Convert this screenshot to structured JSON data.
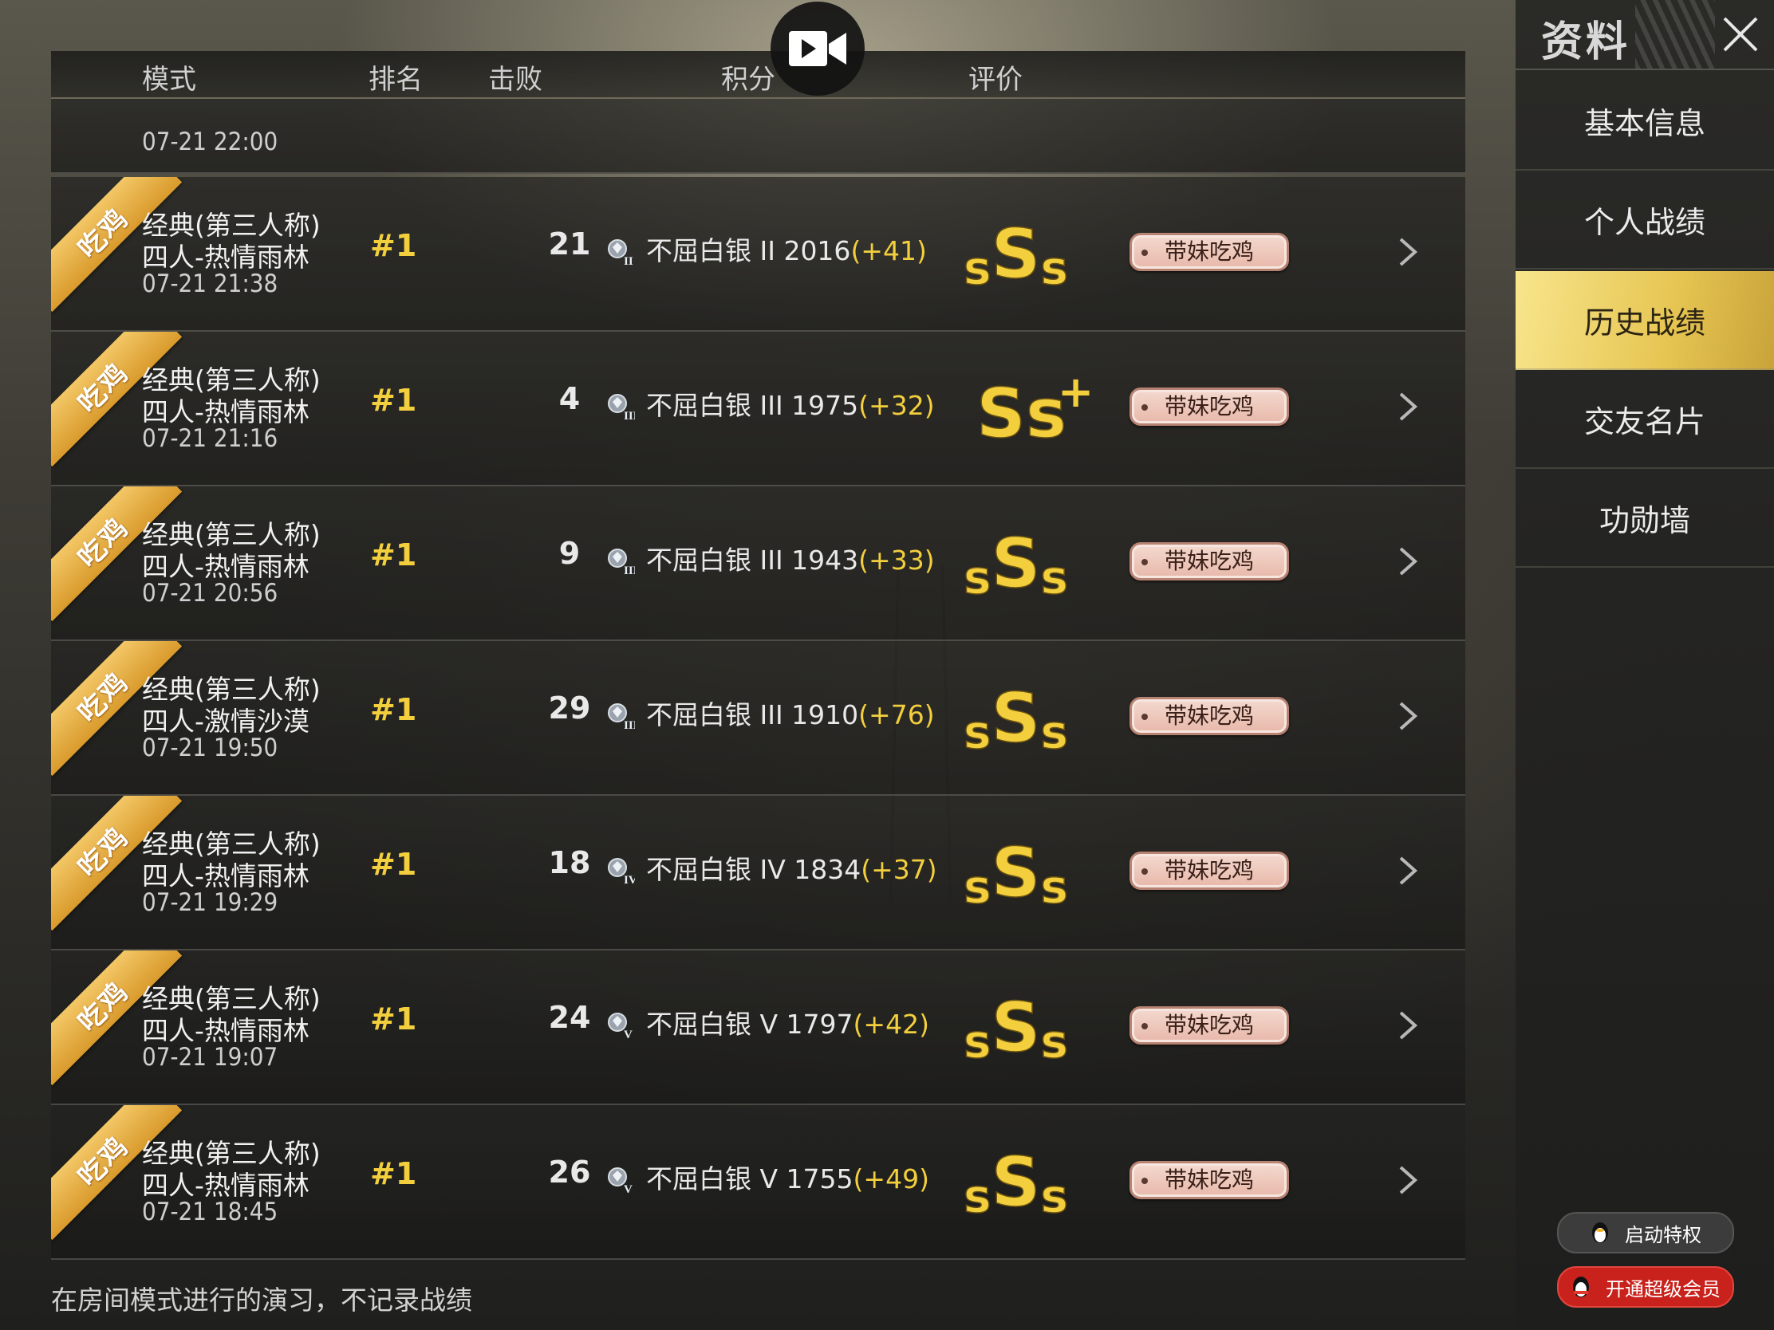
{
  "header": {
    "mode": "模式",
    "rank": "排名",
    "kills": "击败",
    "score": "积分",
    "grade": "评价"
  },
  "partial_row": {
    "time": "07-21 22:00"
  },
  "rows": [
    {
      "ribbon": "吃鸡",
      "mode_line1": "经典(第三人称)",
      "mode_line2": "四人-热情雨林",
      "time": "07-21 21:38",
      "rank": "#1",
      "kills": "21",
      "tier_numeral": "II",
      "score_text": "不屈白银 II 2016",
      "delta": "(+41)",
      "grade_text": "sSs",
      "tag": "带妹吃鸡"
    },
    {
      "ribbon": "吃鸡",
      "mode_line1": "经典(第三人称)",
      "mode_line2": "四人-热情雨林",
      "time": "07-21 21:16",
      "rank": "#1",
      "kills": "4",
      "tier_numeral": "III",
      "score_text": "不屈白银 III 1975",
      "delta": "(+32)",
      "grade_text": "Ss+",
      "tag": "带妹吃鸡"
    },
    {
      "ribbon": "吃鸡",
      "mode_line1": "经典(第三人称)",
      "mode_line2": "四人-热情雨林",
      "time": "07-21 20:56",
      "rank": "#1",
      "kills": "9",
      "tier_numeral": "III",
      "score_text": "不屈白银 III 1943",
      "delta": "(+33)",
      "grade_text": "sSs",
      "tag": "带妹吃鸡"
    },
    {
      "ribbon": "吃鸡",
      "mode_line1": "经典(第三人称)",
      "mode_line2": "四人-激情沙漠",
      "time": "07-21 19:50",
      "rank": "#1",
      "kills": "29",
      "tier_numeral": "III",
      "score_text": "不屈白银 III 1910",
      "delta": "(+76)",
      "grade_text": "sSs",
      "tag": "带妹吃鸡"
    },
    {
      "ribbon": "吃鸡",
      "mode_line1": "经典(第三人称)",
      "mode_line2": "四人-热情雨林",
      "time": "07-21 19:29",
      "rank": "#1",
      "kills": "18",
      "tier_numeral": "IV",
      "score_text": "不屈白银 IV 1834",
      "delta": "(+37)",
      "grade_text": "sSs",
      "tag": "带妹吃鸡"
    },
    {
      "ribbon": "吃鸡",
      "mode_line1": "经典(第三人称)",
      "mode_line2": "四人-热情雨林",
      "time": "07-21 19:07",
      "rank": "#1",
      "kills": "24",
      "tier_numeral": "V",
      "score_text": "不屈白银 V 1797",
      "delta": "(+42)",
      "grade_text": "sSs",
      "tag": "带妹吃鸡"
    },
    {
      "ribbon": "吃鸡",
      "mode_line1": "经典(第三人称)",
      "mode_line2": "四人-热情雨林",
      "time": "07-21 18:45",
      "rank": "#1",
      "kills": "26",
      "tier_numeral": "V",
      "score_text": "不屈白银 V 1755",
      "delta": "(+49)",
      "grade_text": "sSs",
      "tag": "带妹吃鸡"
    }
  ],
  "footer_note": "在房间模式进行的演习，不记录战绩",
  "sidebar": {
    "title": "资料",
    "items": [
      {
        "label": "基本信息",
        "active": false
      },
      {
        "label": "个人战绩",
        "active": false
      },
      {
        "label": "历史战绩",
        "active": true
      },
      {
        "label": "交友名片",
        "active": false
      },
      {
        "label": "功勋墙",
        "active": false
      }
    ],
    "buttons": {
      "privilege": "启动特权",
      "super_member": "开通超级会员"
    }
  },
  "colors": {
    "rank_yellow": "#f3cf3d",
    "ribbon_orange": "#e8ad3f",
    "active_nav_gold": "#eccb5a",
    "tag_pink": "#eec5b7",
    "super_member_red": "#c9221c"
  },
  "icons": {
    "record": "video-camera-icon",
    "close": "close-x-icon",
    "row_arrow": "chevron-right-icon",
    "tier": "silver-tier-badge-icon",
    "qq": "qq-penguin-icon"
  }
}
